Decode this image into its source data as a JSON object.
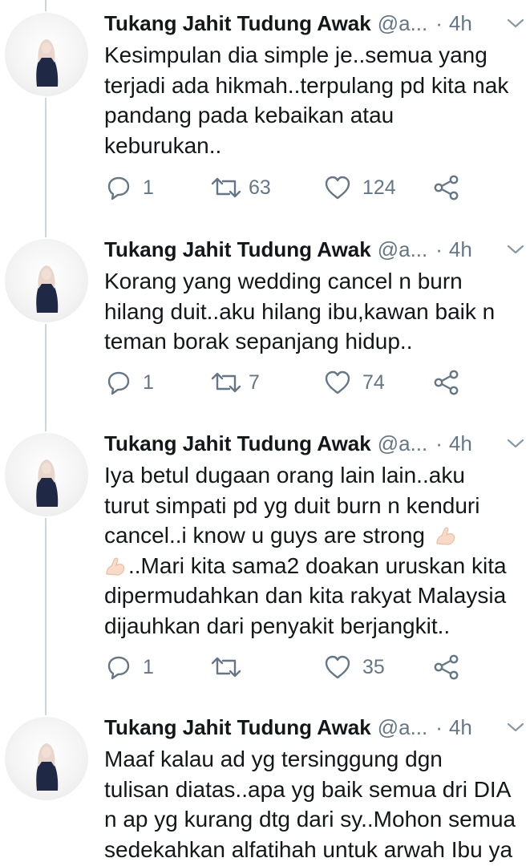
{
  "tweets": [
    {
      "name": "Tukang Jahit Tudung Awak",
      "handle": "@a...",
      "dot": "·",
      "time": "4h",
      "lines": [
        "Kesimpulan dia simple je..semua yang",
        "terjadi ada hikmah..terpulang pd kita nak",
        "pandang pada kebaikan atau",
        "keburukan.."
      ],
      "replies": "1",
      "retweets": "63",
      "likes": "124"
    },
    {
      "name": "Tukang Jahit Tudung Awak",
      "handle": "@a...",
      "dot": "·",
      "time": "4h",
      "lines": [
        "Korang yang wedding cancel n burn",
        "hilang duit..aku hilang ibu,kawan baik n",
        "teman borak sepanjang hidup.."
      ],
      "replies": "1",
      "retweets": "7",
      "likes": "74"
    },
    {
      "name": "Tukang Jahit Tudung Awak",
      "handle": "@a...",
      "dot": "·",
      "time": "4h",
      "lines": [
        "Iya betul dugaan orang lain lain..aku",
        "turut simpati pd yg duit burn n kenduri",
        "cancel..i know u guys are strong",
        "..Mari kita sama2 doakan uruskan kita",
        "dipermudahkan dan kita rakyat Malaysia",
        "dijauhkan dari penyakit berjangkit.."
      ],
      "replies": "1",
      "retweets": "",
      "likes": "35",
      "emoji": "flexed-biceps-emoji"
    },
    {
      "name": "Tukang Jahit Tudung Awak",
      "handle": "@a...",
      "dot": "·",
      "time": "4h",
      "lines": [
        "Maaf kalau ad yg tersinggung dgn",
        "tulisan diatas..apa yg baik semua dri DIA",
        "n ap yg kurang dtg dari sy..Mohon semua",
        "sedekahkan alfatihah untuk arwah Ibu ya"
      ]
    }
  ],
  "icons": {
    "reply": "reply-icon",
    "retweet": "retweet-icon",
    "like": "heart-icon",
    "share": "share-icon",
    "caret": "chevron-down-icon"
  },
  "colors": {
    "text": "#14171a",
    "muted": "#657786",
    "thread_line": "#ccd6dd",
    "emoji_skin": "#f7dac7"
  }
}
